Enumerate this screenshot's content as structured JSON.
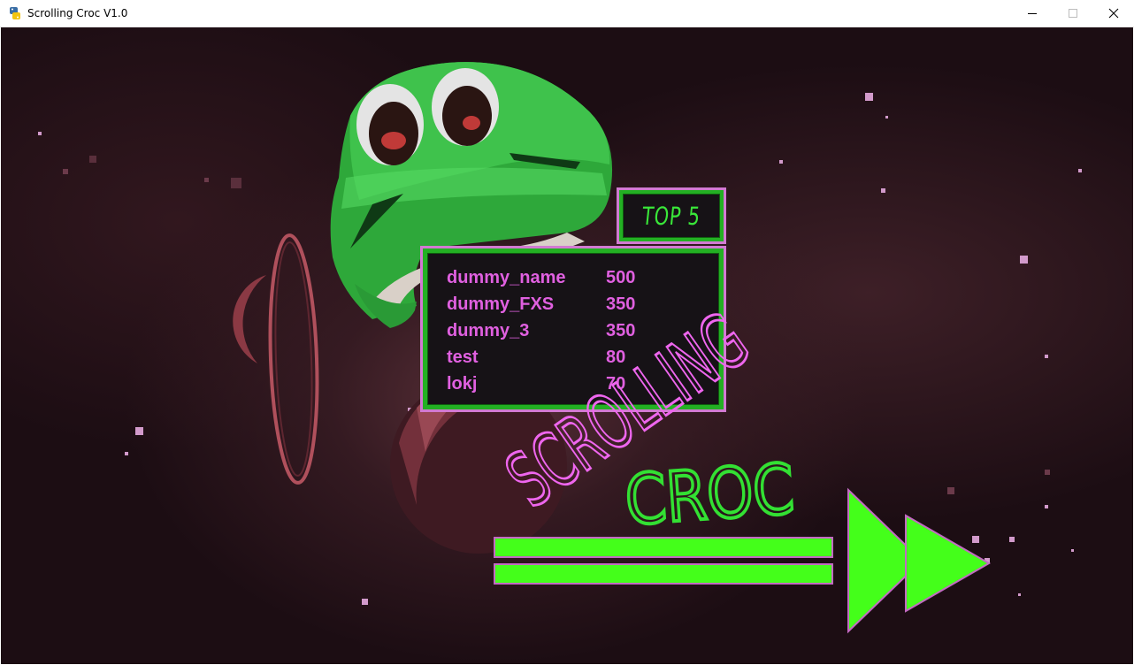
{
  "window": {
    "title": "Scrolling Croc V1.0",
    "icon": "python-icon",
    "controls": [
      "minimize-icon",
      "maximize-icon",
      "close-icon"
    ]
  },
  "leaderboard": {
    "heading": "TOP 5",
    "entries": [
      {
        "name": "dummy_name",
        "score": "500"
      },
      {
        "name": "dummy_FXS",
        "score": "350"
      },
      {
        "name": "dummy_3",
        "score": "350"
      },
      {
        "name": "test",
        "score": "80"
      },
      {
        "name": "lokj",
        "score": "70"
      }
    ]
  },
  "logo": {
    "line1": "SCROLLING",
    "line2": "CROC"
  },
  "play_button": {
    "icon": "fast-forward-icon"
  },
  "colors": {
    "background": "#1c0d13",
    "panel_border_green": "#23b023",
    "panel_outline_pink": "#d27ad2",
    "score_text": "#e060e0",
    "play_green": "#44ff1a",
    "logo_pink": "#ee66ee",
    "logo_green": "#33e033",
    "croc_green": "#2ea83a"
  }
}
